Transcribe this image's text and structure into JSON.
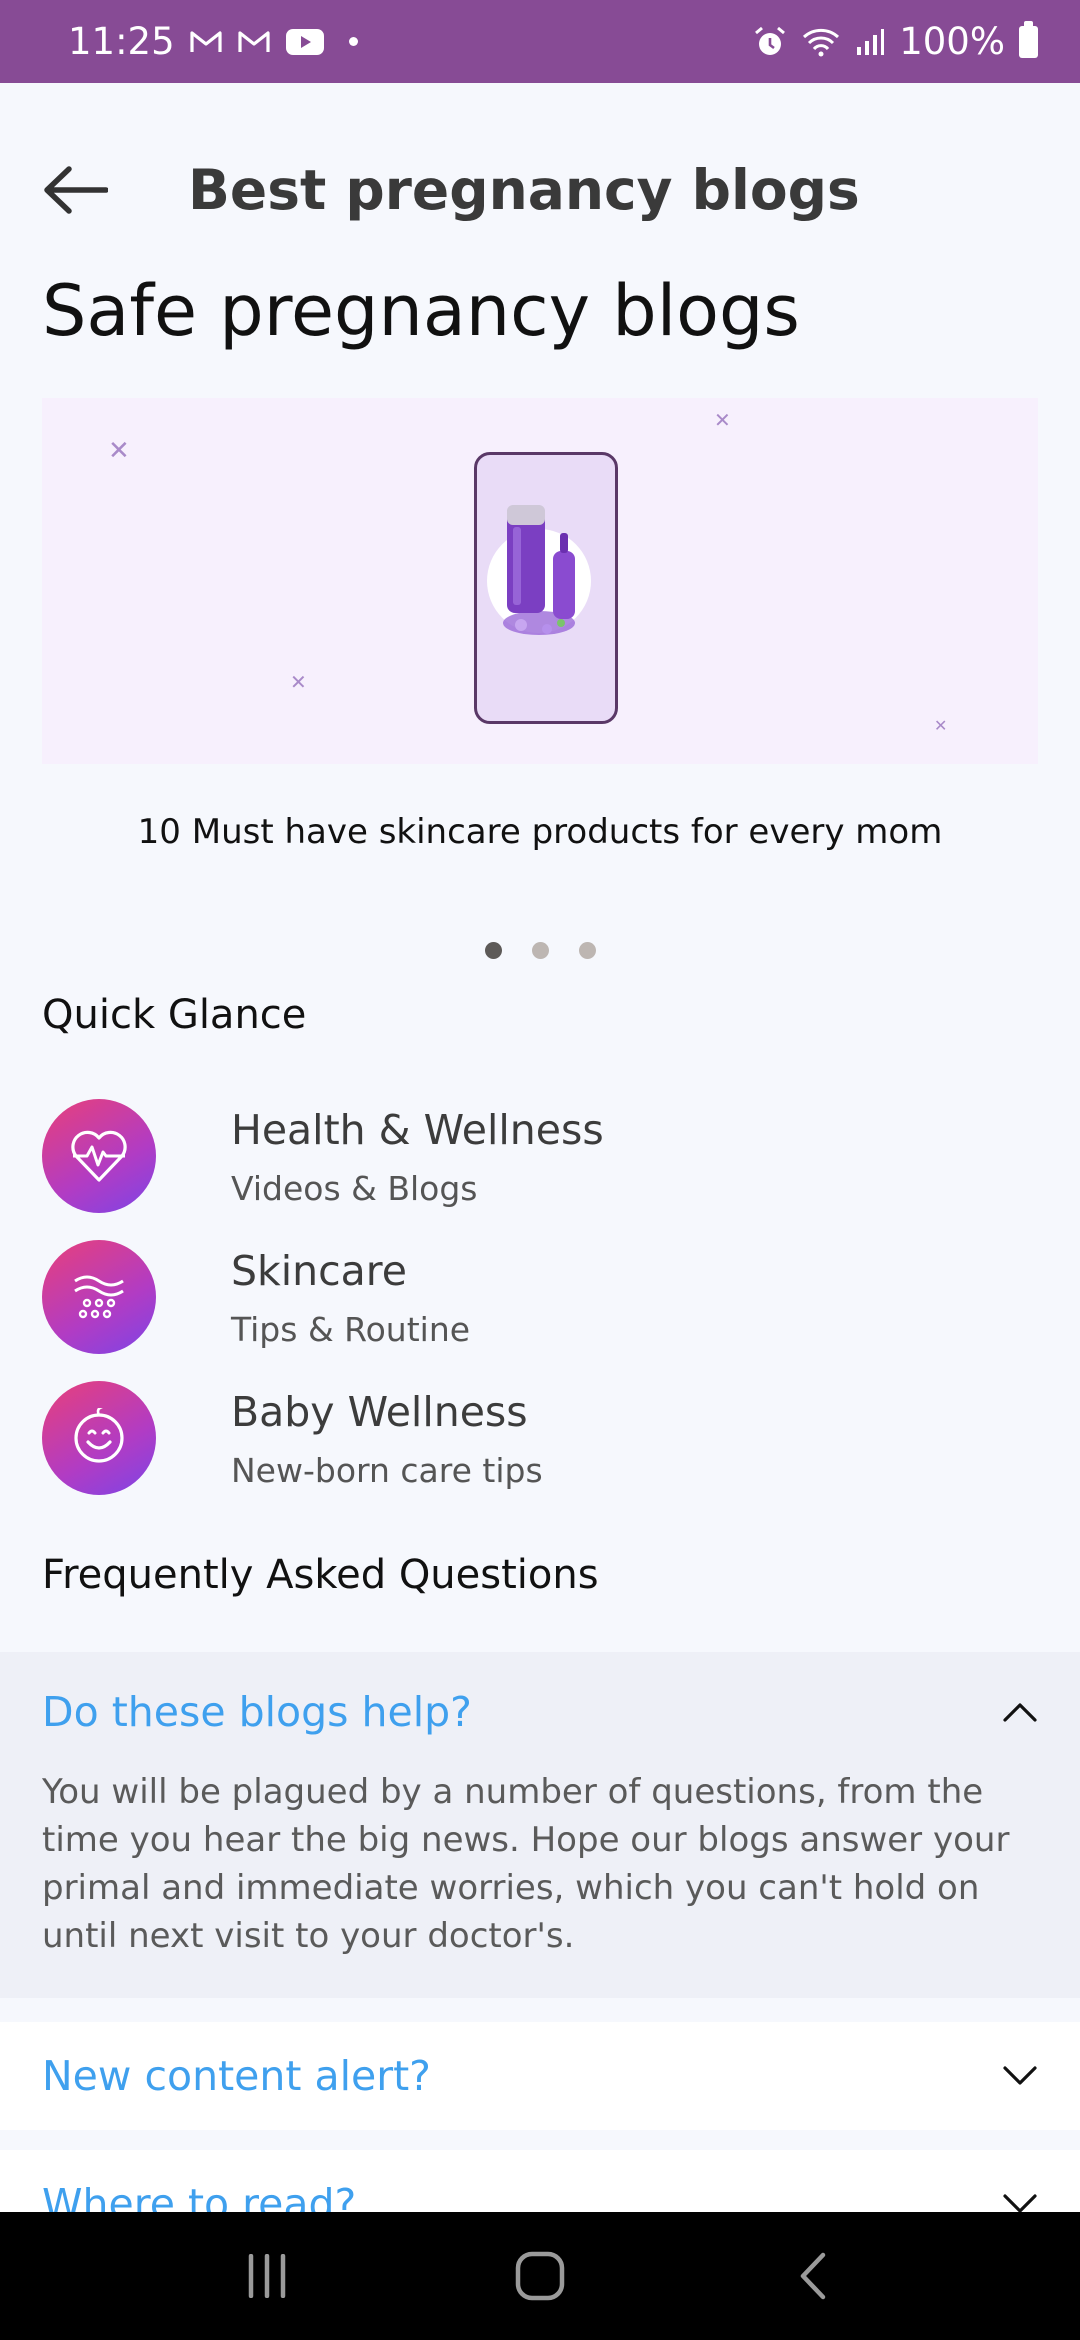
{
  "status_bar": {
    "time": "11:25",
    "battery": "100%",
    "icons": [
      "gmail-icon",
      "gmail-icon",
      "youtube-icon",
      "notification-dot",
      "alarm-icon",
      "wifi-icon",
      "signal-icon",
      "battery-icon"
    ]
  },
  "header": {
    "title": "Best pregnancy blogs",
    "back_icon": "arrow-left-icon"
  },
  "page_title": "Safe pregnancy blogs",
  "carousel": {
    "caption": "10 Must have skincare products for every mom",
    "total_pages": 3,
    "active_page": 1
  },
  "quick_glance": {
    "title": "Quick Glance",
    "items": [
      {
        "title": "Health & Wellness",
        "subtitle": "Videos & Blogs",
        "icon": "heartbeat-icon"
      },
      {
        "title": "Skincare",
        "subtitle": "Tips & Routine",
        "icon": "skin-icon"
      },
      {
        "title": "Baby Wellness",
        "subtitle": "New-born care tips",
        "icon": "smiley-icon"
      }
    ]
  },
  "faq": {
    "title": "Frequently Asked Questions",
    "items": [
      {
        "question": "Do these blogs help?",
        "answer": "You will be plagued by a number of questions, from the time you hear the big news. Hope our blogs answer your primal and immediate worries, which you can't hold on until next visit to your doctor's.",
        "expanded": true
      },
      {
        "question": "New content alert?",
        "expanded": false
      },
      {
        "question": "Where to read?",
        "expanded": false
      }
    ]
  },
  "colors": {
    "status_bar": "#874b95",
    "accent_blue": "#3fa0ee",
    "banner_bg": "#f7f0fd",
    "page_bg": "#f6f8fd"
  },
  "nav_bar": {
    "buttons": [
      "recent-apps-icon",
      "home-icon",
      "back-icon"
    ]
  }
}
